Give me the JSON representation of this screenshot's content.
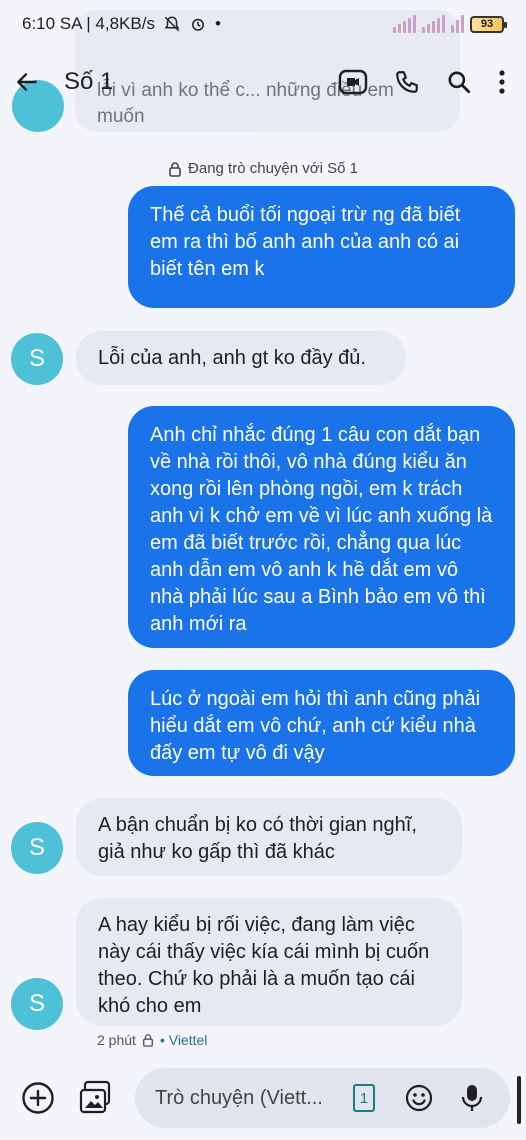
{
  "status_bar": {
    "time_speed": "6:10 SA | 4,8KB/s",
    "dot": "•",
    "battery": "93"
  },
  "ghost": {
    "text": "lỗi vì anh ko thể c... những điều em muốn"
  },
  "header": {
    "title": "Số 1"
  },
  "encryption_label": "Đang trò chuyện với Số 1",
  "messages": [
    {
      "dir": "out",
      "text": "Thế cả buổi tối ngoại trừ ng đã biết em ra thì bố anh anh của anh có ai biết tên em k"
    },
    {
      "dir": "in",
      "avatar": "S",
      "text": "Lỗi của anh, anh gt ko đầy đủ."
    },
    {
      "dir": "out",
      "text": "Anh chỉ nhắc đúng 1 câu con dắt bạn về nhà rồi thôi, vô nhà đúng kiểu ăn xong rồi lên phòng ngồi, em k trách anh vì k chở em về vì lúc anh xuống là em đã biết trước rồi, chẳng qua lúc anh dẫn em vô anh k hề dắt em vô nhà phải lúc sau a Bình bảo em vô thì anh mới ra"
    },
    {
      "dir": "out",
      "text": "Lúc ở ngoài em hỏi thì anh cũng phải hiểu dắt em vô chứ, anh cứ kiểu nhà đấy em tự vô đi vậy"
    },
    {
      "dir": "in",
      "avatar": "S",
      "text": "A bận chuẩn bị ko có thời gian nghĩ, giả như ko gấp thì đã khác"
    },
    {
      "dir": "in",
      "avatar": "S",
      "text": "A hay kiểu bị rối việc, đang làm việc này cái thấy việc kía cái mình bị cuốn theo. Chứ ko phải là a muốn tạo cái khó cho em"
    }
  ],
  "meta": {
    "time": "2 phút",
    "carrier": "• Viettel"
  },
  "compose": {
    "placeholder": "Trò chuyện (Viett...",
    "sim": "1"
  },
  "colors": {
    "outgoing": "#1a73e8",
    "incoming": "#e7e9f0",
    "avatar": "#4ec1d9",
    "background": "#f3f5fa"
  }
}
